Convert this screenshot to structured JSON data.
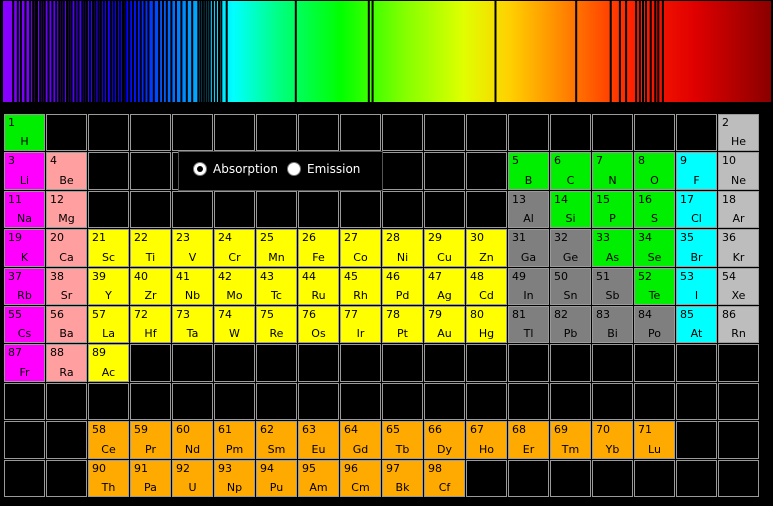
{
  "colors": {
    "alkali": "#ff00ff",
    "alkaline_earth": "#ff9fa0",
    "transition": "#ffff00",
    "post_transition": "#7f7f7f",
    "nonmetal": "#00ee00",
    "halogen": "#00ffff",
    "noble": "#bdbdbd",
    "lanthanide_actinide": "#ffaa00",
    "empty": "#000000"
  },
  "controls": {
    "absorption_label": "Absorption",
    "emission_label": "Emission",
    "selected_mode": "Absorption"
  },
  "spectrum_lines": [
    0.012,
    0.018,
    0.022,
    0.028,
    0.034,
    0.038,
    0.041,
    0.043,
    0.047,
    0.05,
    0.053,
    0.058,
    0.063,
    0.068,
    0.072,
    0.075,
    0.078,
    0.082,
    0.085,
    0.088,
    0.093,
    0.097,
    0.102,
    0.105,
    0.108,
    0.112,
    0.116,
    0.119,
    0.123,
    0.126,
    0.13,
    0.134,
    0.139,
    0.143,
    0.147,
    0.151,
    0.155,
    0.158,
    0.163,
    0.168,
    0.173,
    0.178,
    0.183,
    0.188,
    0.195,
    0.202,
    0.207,
    0.212,
    0.218,
    0.224,
    0.231,
    0.238,
    0.245,
    0.253,
    0.256,
    0.259,
    0.262,
    0.265,
    0.268,
    0.272,
    0.276,
    0.28,
    0.283,
    0.29,
    0.38,
    0.475,
    0.48,
    0.64,
    0.745,
    0.79,
    0.802,
    0.81,
    0.823,
    0.828,
    0.832,
    0.836,
    0.842,
    0.848,
    0.852,
    0.858
  ],
  "elements": [
    {
      "n": 1,
      "s": "H",
      "r": 1,
      "c": 1,
      "t": "nonmetal"
    },
    {
      "n": 2,
      "s": "He",
      "r": 1,
      "c": 18,
      "t": "noble"
    },
    {
      "n": 3,
      "s": "Li",
      "r": 2,
      "c": 1,
      "t": "alkali"
    },
    {
      "n": 4,
      "s": "Be",
      "r": 2,
      "c": 2,
      "t": "alkaline_earth"
    },
    {
      "n": 5,
      "s": "B",
      "r": 2,
      "c": 13,
      "t": "nonmetal"
    },
    {
      "n": 6,
      "s": "C",
      "r": 2,
      "c": 14,
      "t": "nonmetal"
    },
    {
      "n": 7,
      "s": "N",
      "r": 2,
      "c": 15,
      "t": "nonmetal"
    },
    {
      "n": 8,
      "s": "O",
      "r": 2,
      "c": 16,
      "t": "nonmetal"
    },
    {
      "n": 9,
      "s": "F",
      "r": 2,
      "c": 17,
      "t": "halogen"
    },
    {
      "n": 10,
      "s": "Ne",
      "r": 2,
      "c": 18,
      "t": "noble"
    },
    {
      "n": 11,
      "s": "Na",
      "r": 3,
      "c": 1,
      "t": "alkali"
    },
    {
      "n": 12,
      "s": "Mg",
      "r": 3,
      "c": 2,
      "t": "alkaline_earth"
    },
    {
      "n": 13,
      "s": "Al",
      "r": 3,
      "c": 13,
      "t": "post_transition"
    },
    {
      "n": 14,
      "s": "Si",
      "r": 3,
      "c": 14,
      "t": "nonmetal"
    },
    {
      "n": 15,
      "s": "P",
      "r": 3,
      "c": 15,
      "t": "nonmetal"
    },
    {
      "n": 16,
      "s": "S",
      "r": 3,
      "c": 16,
      "t": "nonmetal"
    },
    {
      "n": 17,
      "s": "Cl",
      "r": 3,
      "c": 17,
      "t": "halogen"
    },
    {
      "n": 18,
      "s": "Ar",
      "r": 3,
      "c": 18,
      "t": "noble"
    },
    {
      "n": 19,
      "s": "K",
      "r": 4,
      "c": 1,
      "t": "alkali"
    },
    {
      "n": 20,
      "s": "Ca",
      "r": 4,
      "c": 2,
      "t": "alkaline_earth"
    },
    {
      "n": 21,
      "s": "Sc",
      "r": 4,
      "c": 3,
      "t": "transition"
    },
    {
      "n": 22,
      "s": "Ti",
      "r": 4,
      "c": 4,
      "t": "transition"
    },
    {
      "n": 23,
      "s": "V",
      "r": 4,
      "c": 5,
      "t": "transition"
    },
    {
      "n": 24,
      "s": "Cr",
      "r": 4,
      "c": 6,
      "t": "transition"
    },
    {
      "n": 25,
      "s": "Mn",
      "r": 4,
      "c": 7,
      "t": "transition"
    },
    {
      "n": 26,
      "s": "Fe",
      "r": 4,
      "c": 8,
      "t": "transition"
    },
    {
      "n": 27,
      "s": "Co",
      "r": 4,
      "c": 9,
      "t": "transition"
    },
    {
      "n": 28,
      "s": "Ni",
      "r": 4,
      "c": 10,
      "t": "transition"
    },
    {
      "n": 29,
      "s": "Cu",
      "r": 4,
      "c": 11,
      "t": "transition"
    },
    {
      "n": 30,
      "s": "Zn",
      "r": 4,
      "c": 12,
      "t": "transition"
    },
    {
      "n": 31,
      "s": "Ga",
      "r": 4,
      "c": 13,
      "t": "post_transition"
    },
    {
      "n": 32,
      "s": "Ge",
      "r": 4,
      "c": 14,
      "t": "post_transition"
    },
    {
      "n": 33,
      "s": "As",
      "r": 4,
      "c": 15,
      "t": "nonmetal"
    },
    {
      "n": 34,
      "s": "Se",
      "r": 4,
      "c": 16,
      "t": "nonmetal"
    },
    {
      "n": 35,
      "s": "Br",
      "r": 4,
      "c": 17,
      "t": "halogen"
    },
    {
      "n": 36,
      "s": "Kr",
      "r": 4,
      "c": 18,
      "t": "noble"
    },
    {
      "n": 37,
      "s": "Rb",
      "r": 5,
      "c": 1,
      "t": "alkali"
    },
    {
      "n": 38,
      "s": "Sr",
      "r": 5,
      "c": 2,
      "t": "alkaline_earth"
    },
    {
      "n": 39,
      "s": "Y",
      "r": 5,
      "c": 3,
      "t": "transition"
    },
    {
      "n": 40,
      "s": "Zr",
      "r": 5,
      "c": 4,
      "t": "transition"
    },
    {
      "n": 41,
      "s": "Nb",
      "r": 5,
      "c": 5,
      "t": "transition"
    },
    {
      "n": 42,
      "s": "Mo",
      "r": 5,
      "c": 6,
      "t": "transition"
    },
    {
      "n": 43,
      "s": "Tc",
      "r": 5,
      "c": 7,
      "t": "transition"
    },
    {
      "n": 44,
      "s": "Ru",
      "r": 5,
      "c": 8,
      "t": "transition"
    },
    {
      "n": 45,
      "s": "Rh",
      "r": 5,
      "c": 9,
      "t": "transition"
    },
    {
      "n": 46,
      "s": "Pd",
      "r": 5,
      "c": 10,
      "t": "transition"
    },
    {
      "n": 47,
      "s": "Ag",
      "r": 5,
      "c": 11,
      "t": "transition"
    },
    {
      "n": 48,
      "s": "Cd",
      "r": 5,
      "c": 12,
      "t": "transition"
    },
    {
      "n": 49,
      "s": "In",
      "r": 5,
      "c": 13,
      "t": "post_transition"
    },
    {
      "n": 50,
      "s": "Sn",
      "r": 5,
      "c": 14,
      "t": "post_transition"
    },
    {
      "n": 51,
      "s": "Sb",
      "r": 5,
      "c": 15,
      "t": "post_transition"
    },
    {
      "n": 52,
      "s": "Te",
      "r": 5,
      "c": 16,
      "t": "nonmetal"
    },
    {
      "n": 53,
      "s": "I",
      "r": 5,
      "c": 17,
      "t": "halogen"
    },
    {
      "n": 54,
      "s": "Xe",
      "r": 5,
      "c": 18,
      "t": "noble"
    },
    {
      "n": 55,
      "s": "Cs",
      "r": 6,
      "c": 1,
      "t": "alkali"
    },
    {
      "n": 56,
      "s": "Ba",
      "r": 6,
      "c": 2,
      "t": "alkaline_earth"
    },
    {
      "n": 57,
      "s": "La",
      "r": 6,
      "c": 3,
      "t": "transition"
    },
    {
      "n": 72,
      "s": "Hf",
      "r": 6,
      "c": 4,
      "t": "transition"
    },
    {
      "n": 73,
      "s": "Ta",
      "r": 6,
      "c": 5,
      "t": "transition"
    },
    {
      "n": 74,
      "s": "W",
      "r": 6,
      "c": 6,
      "t": "transition"
    },
    {
      "n": 75,
      "s": "Re",
      "r": 6,
      "c": 7,
      "t": "transition"
    },
    {
      "n": 76,
      "s": "Os",
      "r": 6,
      "c": 8,
      "t": "transition"
    },
    {
      "n": 77,
      "s": "Ir",
      "r": 6,
      "c": 9,
      "t": "transition"
    },
    {
      "n": 78,
      "s": "Pt",
      "r": 6,
      "c": 10,
      "t": "transition"
    },
    {
      "n": 79,
      "s": "Au",
      "r": 6,
      "c": 11,
      "t": "transition"
    },
    {
      "n": 80,
      "s": "Hg",
      "r": 6,
      "c": 12,
      "t": "transition"
    },
    {
      "n": 81,
      "s": "Tl",
      "r": 6,
      "c": 13,
      "t": "post_transition"
    },
    {
      "n": 82,
      "s": "Pb",
      "r": 6,
      "c": 14,
      "t": "post_transition"
    },
    {
      "n": 83,
      "s": "Bi",
      "r": 6,
      "c": 15,
      "t": "post_transition"
    },
    {
      "n": 84,
      "s": "Po",
      "r": 6,
      "c": 16,
      "t": "post_transition"
    },
    {
      "n": 85,
      "s": "At",
      "r": 6,
      "c": 17,
      "t": "halogen"
    },
    {
      "n": 86,
      "s": "Rn",
      "r": 6,
      "c": 18,
      "t": "noble"
    },
    {
      "n": 87,
      "s": "Fr",
      "r": 7,
      "c": 1,
      "t": "alkali"
    },
    {
      "n": 88,
      "s": "Ra",
      "r": 7,
      "c": 2,
      "t": "alkaline_earth"
    },
    {
      "n": 89,
      "s": "Ac",
      "r": 7,
      "c": 3,
      "t": "transition"
    },
    {
      "n": 58,
      "s": "Ce",
      "r": 9,
      "c": 3,
      "t": "lanthanide_actinide"
    },
    {
      "n": 59,
      "s": "Pr",
      "r": 9,
      "c": 4,
      "t": "lanthanide_actinide"
    },
    {
      "n": 60,
      "s": "Nd",
      "r": 9,
      "c": 5,
      "t": "lanthanide_actinide"
    },
    {
      "n": 61,
      "s": "Pm",
      "r": 9,
      "c": 6,
      "t": "lanthanide_actinide"
    },
    {
      "n": 62,
      "s": "Sm",
      "r": 9,
      "c": 7,
      "t": "lanthanide_actinide"
    },
    {
      "n": 63,
      "s": "Eu",
      "r": 9,
      "c": 8,
      "t": "lanthanide_actinide"
    },
    {
      "n": 64,
      "s": "Gd",
      "r": 9,
      "c": 9,
      "t": "lanthanide_actinide"
    },
    {
      "n": 65,
      "s": "Tb",
      "r": 9,
      "c": 10,
      "t": "lanthanide_actinide"
    },
    {
      "n": 66,
      "s": "Dy",
      "r": 9,
      "c": 11,
      "t": "lanthanide_actinide"
    },
    {
      "n": 67,
      "s": "Ho",
      "r": 9,
      "c": 12,
      "t": "lanthanide_actinide"
    },
    {
      "n": 68,
      "s": "Er",
      "r": 9,
      "c": 13,
      "t": "lanthanide_actinide"
    },
    {
      "n": 69,
      "s": "Tm",
      "r": 9,
      "c": 14,
      "t": "lanthanide_actinide"
    },
    {
      "n": 70,
      "s": "Yb",
      "r": 9,
      "c": 15,
      "t": "lanthanide_actinide"
    },
    {
      "n": 71,
      "s": "Lu",
      "r": 9,
      "c": 16,
      "t": "lanthanide_actinide"
    },
    {
      "n": 90,
      "s": "Th",
      "r": 10,
      "c": 3,
      "t": "lanthanide_actinide"
    },
    {
      "n": 91,
      "s": "Pa",
      "r": 10,
      "c": 4,
      "t": "lanthanide_actinide"
    },
    {
      "n": 92,
      "s": "U",
      "r": 10,
      "c": 5,
      "t": "lanthanide_actinide"
    },
    {
      "n": 93,
      "s": "Np",
      "r": 10,
      "c": 6,
      "t": "lanthanide_actinide"
    },
    {
      "n": 94,
      "s": "Pu",
      "r": 10,
      "c": 7,
      "t": "lanthanide_actinide"
    },
    {
      "n": 95,
      "s": "Am",
      "r": 10,
      "c": 8,
      "t": "lanthanide_actinide"
    },
    {
      "n": 96,
      "s": "Cm",
      "r": 10,
      "c": 9,
      "t": "lanthanide_actinide"
    },
    {
      "n": 97,
      "s": "Bk",
      "r": 10,
      "c": 10,
      "t": "lanthanide_actinide"
    },
    {
      "n": 98,
      "s": "Cf",
      "r": 10,
      "c": 11,
      "t": "lanthanide_actinide"
    }
  ]
}
